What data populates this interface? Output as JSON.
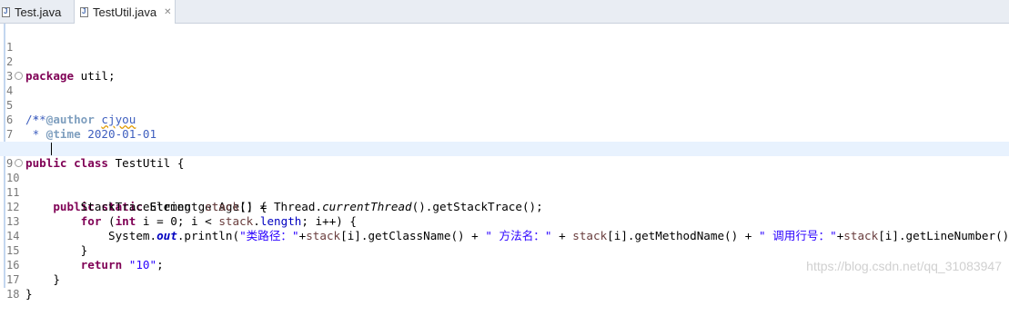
{
  "tabs": [
    {
      "label": "Test.java",
      "active": false
    },
    {
      "label": "TestUtil.java",
      "active": true
    }
  ],
  "close_glyph": "✕",
  "line_numbers": [
    "1",
    "2",
    "3",
    "4",
    "5",
    "6",
    "7",
    "8",
    "9",
    "10",
    "11",
    "12",
    "13",
    "14",
    "15",
    "16",
    "17",
    "18"
  ],
  "code": {
    "l2_kw": "package",
    "l2_rest": " util;",
    "l4": "/**",
    "l5_pre": " * ",
    "l5_tag": "@author",
    "l5_sp": " ",
    "l5_name": "cjyou",
    "l6_pre": " * ",
    "l6_tag": "@time",
    "l6_rest": " 2020-01-01",
    "l7": " */",
    "l8_kw1": "public",
    "l8_sp": " ",
    "l8_kw2": "class",
    "l8_rest": " TestUtil {",
    "l10_ind": "    ",
    "l10_kw1": "public",
    "l10_sp1": " ",
    "l10_kw2": "static",
    "l10_rest": " String getAge() {",
    "l11_ind": "        StackTraceElement ",
    "l11_var": "stack",
    "l11_mid": "[] = Thread.",
    "l11_meth": "currentThread",
    "l11_end": "().getStackTrace();",
    "l12_ind": "        ",
    "l12_kw1": "for",
    "l12_a": " (",
    "l12_kw2": "int",
    "l12_b": " i = 0; i < ",
    "l12_var": "stack",
    "l12_dot": ".",
    "l12_fld": "length",
    "l12_c": "; i++) {",
    "l13_ind": "            System.",
    "l13_out": "out",
    "l13_a": ".println(",
    "l13_s1": "\"类路径：\"",
    "l13_b": "+",
    "l13_v1": "stack",
    "l13_c": "[i].getClassName() + ",
    "l13_s2": "\" 方法名：\"",
    "l13_d": " + ",
    "l13_v2": "stack",
    "l13_e": "[i].getMethodName() + ",
    "l13_s3": "\" 调用行号：\"",
    "l13_f": "+",
    "l13_v3": "stack",
    "l13_g": "[i].getLineNumber());",
    "l14": "        }",
    "l15_ind": "        ",
    "l15_kw": "return",
    "l15_sp": " ",
    "l15_str": "\"10\"",
    "l15_end": ";",
    "l16": "    }",
    "l17": "}"
  },
  "fold_glyph": "⊖",
  "watermark": "https://blog.csdn.net/qq_31083947",
  "colors": {
    "keyword": "#7f0055",
    "comment": "#3f5fbf",
    "string": "#2a00ff",
    "field": "#0000c0",
    "current_line": "#e8f2fe"
  }
}
